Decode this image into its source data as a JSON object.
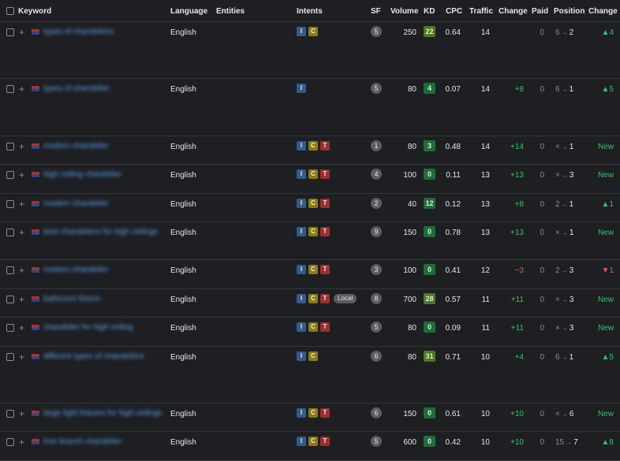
{
  "header": {
    "keyword": "Keyword",
    "language": "Language",
    "entities": "Entities",
    "intents": "Intents",
    "sf": "SF",
    "volume": "Volume",
    "kd": "KD",
    "cpc": "CPC",
    "traffic": "Traffic",
    "change": "Change",
    "paid": "Paid",
    "position": "Position",
    "position_change": "Change"
  },
  "rows": [
    {
      "keyword": "types of chandeliers",
      "language": "English",
      "intents": [
        "I",
        "C"
      ],
      "local": "",
      "sf": "5",
      "volume": "250",
      "kd": "22",
      "cpc": "0.64",
      "traffic": "14",
      "change": "",
      "paid": "0",
      "pos_from": "6",
      "pos_arrow": "→",
      "pos_to": "2",
      "pos_change": "▲4"
    },
    {
      "keyword": "types of chandelier",
      "language": "English",
      "intents": [
        "I"
      ],
      "local": "",
      "sf": "5",
      "volume": "80",
      "kd": "4",
      "cpc": "0.07",
      "traffic": "14",
      "change": "+8",
      "paid": "0",
      "pos_from": "6",
      "pos_arrow": "→",
      "pos_to": "1",
      "pos_change": "▲5"
    },
    {
      "keyword": "modern chandelier",
      "language": "English",
      "intents": [
        "I",
        "C",
        "T"
      ],
      "local": "",
      "sf": "1",
      "volume": "80",
      "kd": "3",
      "cpc": "0.48",
      "traffic": "14",
      "change": "+14",
      "paid": "0",
      "pos_from": "×",
      "pos_arrow": "→",
      "pos_to": "1",
      "pos_change": "New"
    },
    {
      "keyword": "high ceiling chandelier",
      "language": "English",
      "intents": [
        "I",
        "C",
        "T"
      ],
      "local": "",
      "sf": "4",
      "volume": "100",
      "kd": "0",
      "cpc": "0.11",
      "traffic": "13",
      "change": "+13",
      "paid": "0",
      "pos_from": "×",
      "pos_arrow": "→",
      "pos_to": "3",
      "pos_change": "New"
    },
    {
      "keyword": "modern chandelier",
      "language": "English",
      "intents": [
        "I",
        "C",
        "T"
      ],
      "local": "",
      "sf": "2",
      "volume": "40",
      "kd": "12",
      "cpc": "0.12",
      "traffic": "13",
      "change": "+8",
      "paid": "0",
      "pos_from": "2",
      "pos_arrow": "→",
      "pos_to": "1",
      "pos_change": "▲1"
    },
    {
      "keyword": "best chandeliers for high ceilings",
      "language": "English",
      "intents": [
        "I",
        "C",
        "T"
      ],
      "local": "",
      "sf": "9",
      "volume": "150",
      "kd": "0",
      "cpc": "0.78",
      "traffic": "13",
      "change": "+13",
      "paid": "0",
      "pos_from": "×",
      "pos_arrow": "→",
      "pos_to": "1",
      "pos_change": "New"
    },
    {
      "keyword": "modern chandelier",
      "language": "English",
      "intents": [
        "I",
        "C",
        "T"
      ],
      "local": "",
      "sf": "3",
      "volume": "100",
      "kd": "0",
      "cpc": "0.41",
      "traffic": "12",
      "change": "−3",
      "paid": "0",
      "pos_from": "2",
      "pos_arrow": "→",
      "pos_to": "3",
      "pos_change": "▼1"
    },
    {
      "keyword": "bathroom fixture",
      "language": "English",
      "intents": [
        "I",
        "C",
        "T"
      ],
      "local": "Local",
      "sf": "8",
      "volume": "700",
      "kd": "28",
      "cpc": "0.57",
      "traffic": "11",
      "change": "+11",
      "paid": "0",
      "pos_from": "×",
      "pos_arrow": "→",
      "pos_to": "3",
      "pos_change": "New"
    },
    {
      "keyword": "chandelier for high ceiling",
      "language": "English",
      "intents": [
        "I",
        "C",
        "T"
      ],
      "local": "",
      "sf": "5",
      "volume": "80",
      "kd": "0",
      "cpc": "0.09",
      "traffic": "11",
      "change": "+11",
      "paid": "0",
      "pos_from": "×",
      "pos_arrow": "→",
      "pos_to": "3",
      "pos_change": "New"
    },
    {
      "keyword": "different types of chandeliers",
      "language": "English",
      "intents": [
        "I",
        "C"
      ],
      "local": "",
      "sf": "6",
      "volume": "80",
      "kd": "31",
      "cpc": "0.71",
      "traffic": "10",
      "change": "+4",
      "paid": "0",
      "pos_from": "6",
      "pos_arrow": "→",
      "pos_to": "1",
      "pos_change": "▲5"
    },
    {
      "keyword": "large light fixtures for high ceilings",
      "language": "English",
      "intents": [
        "I",
        "C",
        "T"
      ],
      "local": "",
      "sf": "6",
      "volume": "150",
      "kd": "0",
      "cpc": "0.61",
      "traffic": "10",
      "change": "+10",
      "paid": "0",
      "pos_from": "×",
      "pos_arrow": "→",
      "pos_to": "6",
      "pos_change": "New"
    },
    {
      "keyword": "tree branch chandelier",
      "language": "English",
      "intents": [
        "I",
        "C",
        "T"
      ],
      "local": "",
      "sf": "5",
      "volume": "600",
      "kd": "0",
      "cpc": "0.42",
      "traffic": "10",
      "change": "+10",
      "paid": "0",
      "pos_from": "15",
      "pos_arrow": "→",
      "pos_to": "7",
      "pos_change": "▲8"
    }
  ]
}
